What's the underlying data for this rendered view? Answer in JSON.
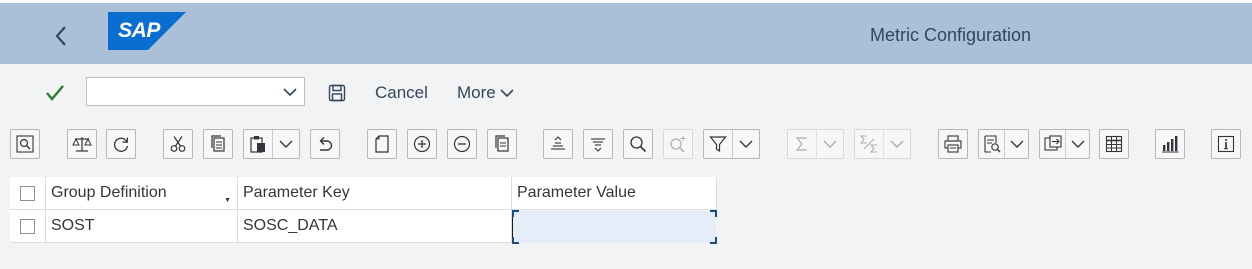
{
  "shell": {
    "logo_text": "SAP",
    "title": "Metric Configuration",
    "header_color": "#a9c0d6",
    "logo_color": "#0a6ed1"
  },
  "toolbar": {
    "combo_value": "",
    "cancel_label": "Cancel",
    "more_label": "More",
    "check_color": "#2b7c2b"
  },
  "alv_toolbar": {
    "buttons": [
      "zoom-details-icon",
      "balance-check-icon",
      "refresh-icon",
      "cut-icon",
      "copy-icon",
      "paste-icon",
      "undo-icon",
      "new-row-icon",
      "insert-row-icon",
      "delete-row-icon",
      "duplicate-row-icon",
      "sort-ascending-icon",
      "sort-descending-icon",
      "find-icon",
      "find-next-icon",
      "filter-icon",
      "sum-icon",
      "subtotal-icon",
      "print-icon",
      "print-preview-icon",
      "export-icon",
      "layout-icon",
      "chart-icon",
      "information-icon"
    ]
  },
  "table": {
    "columns": [
      "Group Definition",
      "Parameter Key",
      "Parameter Value"
    ],
    "rows": [
      {
        "group_definition": "SOST",
        "parameter_key": "SOSC_DATA",
        "parameter_value": ""
      }
    ]
  }
}
